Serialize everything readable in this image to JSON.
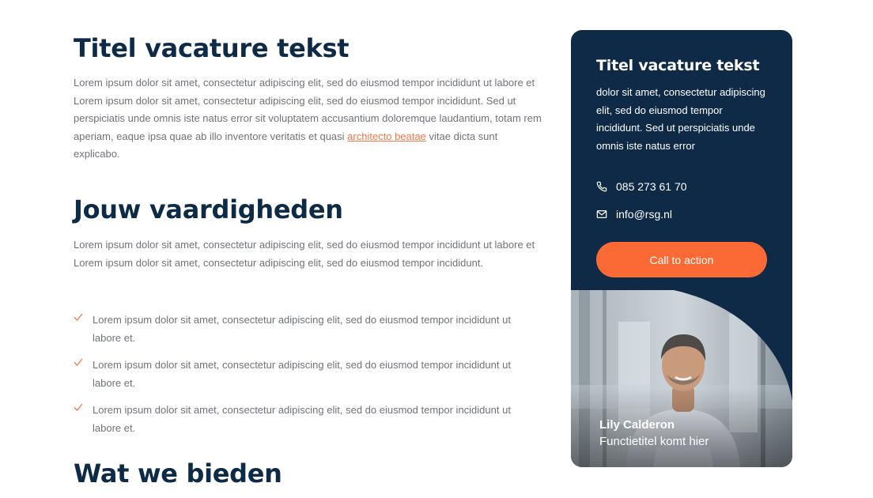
{
  "section1": {
    "heading": "Titel vacature tekst",
    "paragraph_before_link": "Lorem ipsum dolor sit amet, consectetur adipiscing elit, sed do eiusmod tempor incididunt ut labore et Lorem ipsum dolor sit amet, consectetur adipiscing elit, sed do eiusmod tempor incididunt. Sed ut perspiciatis unde omnis iste natus error sit voluptatem accusantium doloremque laudantium, totam rem aperiam, eaque ipsa quae ab illo inventore veritatis et quasi ",
    "link_text": "architecto beatae",
    "paragraph_after_link": " vitae dicta sunt explicabo."
  },
  "section2": {
    "heading": "Jouw vaardigheden",
    "paragraph": "Lorem ipsum dolor sit amet, consectetur adipiscing elit, sed do eiusmod tempor incididunt ut labore et Lorem ipsum dolor sit amet, consectetur adipiscing elit, sed do eiusmod tempor incididunt.",
    "items": [
      "Lorem ipsum dolor sit amet, consectetur adipiscing elit, sed do eiusmod tempor incididunt ut labore et.",
      "Lorem ipsum dolor sit amet, consectetur adipiscing elit, sed do eiusmod tempor incididunt ut labore et.",
      "Lorem ipsum dolor sit amet, consectetur adipiscing elit, sed do eiusmod tempor incididunt ut labore et."
    ]
  },
  "section3": {
    "heading": "Wat we bieden"
  },
  "card": {
    "title": "Titel vacature tekst",
    "text": "dolor sit amet, consectetur adipiscing elit, sed do eiusmod tempor incididunt. Sed ut perspiciatis unde omnis iste natus error",
    "phone": "085 273 61 70",
    "email": "info@rsg.nl",
    "cta_label": "Call to action",
    "person_name": "Lily Calderon",
    "person_role": "Functietitel komt hier",
    "phone_icon": "phone-icon",
    "email_icon": "envelope-icon"
  },
  "colors": {
    "navy": "#0e2a47",
    "accent": "#fb6a34",
    "link": "#f2774a"
  }
}
